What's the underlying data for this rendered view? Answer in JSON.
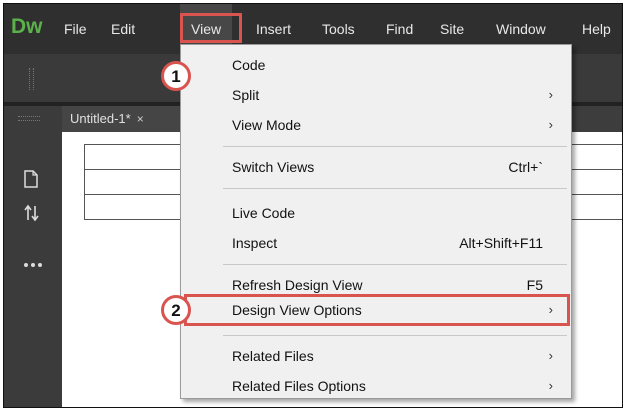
{
  "app": {
    "logo": "Dw",
    "brand_color": "#5bb24a",
    "accent_color": "#d9534f"
  },
  "menubar": {
    "items": [
      {
        "label": "File"
      },
      {
        "label": "Edit"
      },
      {
        "label": "View",
        "active": true
      },
      {
        "label": "Insert"
      },
      {
        "label": "Tools"
      },
      {
        "label": "Find"
      },
      {
        "label": "Site"
      },
      {
        "label": "Window"
      },
      {
        "label": "Help"
      }
    ]
  },
  "document": {
    "tab_label": "Untitled-1*",
    "close_glyph": "×",
    "table_rows": 3
  },
  "left_rail": {
    "icons": [
      "file-icon",
      "sort-arrows-icon",
      "more-dots-icon"
    ]
  },
  "view_menu": {
    "items": [
      {
        "label": "Code",
        "shortcut": "",
        "submenu": false
      },
      {
        "label": "Split",
        "shortcut": "",
        "submenu": true
      },
      {
        "label": "View Mode",
        "shortcut": "",
        "submenu": true
      },
      {
        "label": "Switch Views",
        "shortcut": "Ctrl+`",
        "submenu": false
      },
      {
        "label": "Live Code",
        "shortcut": "",
        "submenu": false
      },
      {
        "label": "Inspect",
        "shortcut": "Alt+Shift+F11",
        "submenu": false
      },
      {
        "label": "Refresh Design View",
        "shortcut": "F5",
        "submenu": false
      },
      {
        "label": "Design View Options",
        "shortcut": "",
        "submenu": true,
        "highlighted": true
      },
      {
        "label": "Related Files",
        "shortcut": "",
        "submenu": true
      },
      {
        "label": "Related Files Options",
        "shortcut": "",
        "submenu": true
      }
    ],
    "submenu_glyph": "›"
  },
  "annotations": {
    "step1": "1",
    "step2": "2"
  }
}
